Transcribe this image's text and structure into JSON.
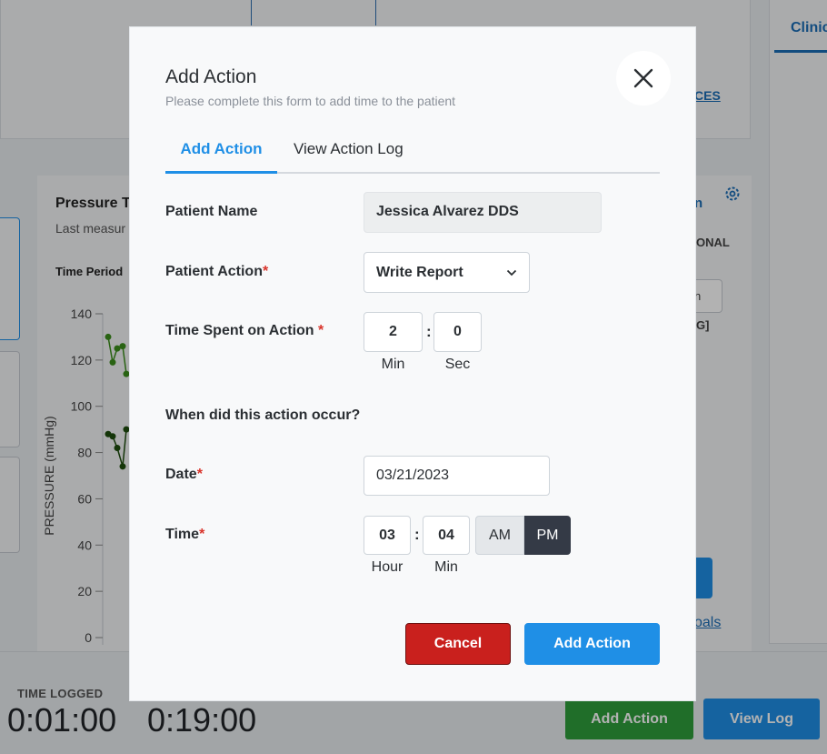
{
  "background": {
    "top_link": "CES",
    "right_tab": "Clinic",
    "chart_title": "Pressure T",
    "chart_subtitle": "Last measur",
    "time_period": "Time Period",
    "chart_right_label": "n",
    "chart_right_header": "ONAL",
    "chart_right_input": "n",
    "chart_right_unit": "G]",
    "goals_link": "oals",
    "footer": {
      "time_logged_label": "TIME LOGGED",
      "time_value_1": "0:01:00",
      "time_value_2": "0:19:00",
      "add_action_button": "Add Action",
      "view_log_button": "View Log"
    },
    "chart_data": {
      "type": "line",
      "ylabel": "PRESSURE (mmHg)",
      "ylim": [
        0,
        140
      ],
      "yticks": [
        "140",
        "120",
        "100",
        "80",
        "60",
        "40",
        "20",
        "0"
      ],
      "series": [
        {
          "color": "#3c8f1c",
          "values": [
            130,
            119,
            125,
            126,
            114
          ]
        },
        {
          "color": "#1d4d0d",
          "values": [
            88,
            87,
            82,
            74,
            90
          ]
        }
      ]
    }
  },
  "modal": {
    "title": "Add Action",
    "subtitle": "Please complete this form to add time to the patient",
    "close_icon": "close-icon",
    "tabs": [
      {
        "label": "Add Action",
        "active": true
      },
      {
        "label": "View Action Log",
        "active": false
      }
    ],
    "form": {
      "patient_name_label": "Patient Name",
      "patient_name_value": "Jessica Alvarez DDS",
      "patient_action_label": "Patient Action",
      "patient_action_value": "Write Report",
      "time_spent_label": "Time Spent on Action",
      "time_min_value": "2",
      "time_sec_value": "0",
      "min_unit": "Min",
      "sec_unit": "Sec",
      "occurred_question": "When did this action occur?",
      "date_label": "Date",
      "date_value": "03/21/2023",
      "time_label": "Time",
      "hour_value": "03",
      "minute_value": "04",
      "hour_unit": "Hour",
      "minute_unit": "Min",
      "am_label": "AM",
      "pm_label": "PM",
      "selected_period": "PM",
      "required_marker": "*"
    },
    "buttons": {
      "cancel": "Cancel",
      "add": "Add Action"
    }
  }
}
